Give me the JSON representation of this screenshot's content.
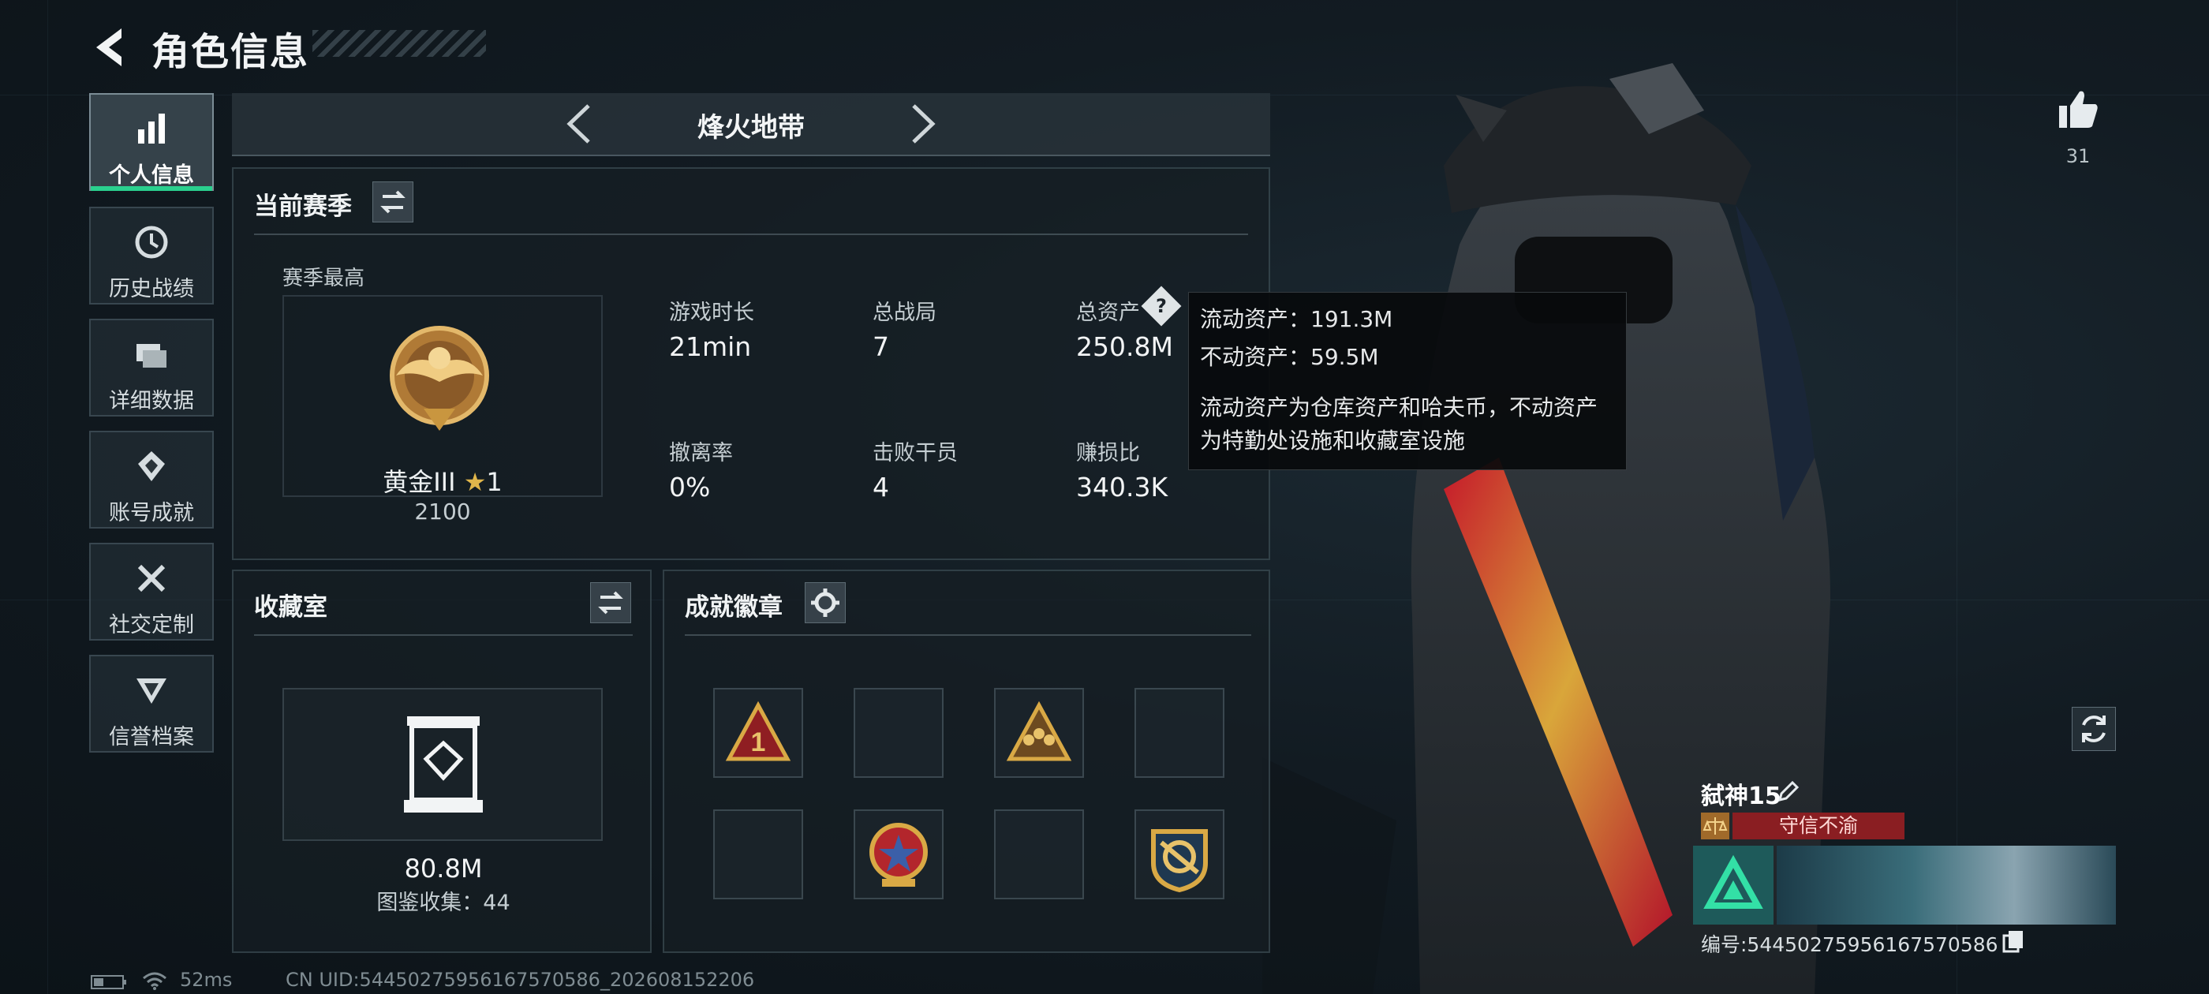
{
  "header": {
    "title": "角色信息"
  },
  "sidebar": {
    "items": [
      {
        "label": "个人信息",
        "icon": "bar-chart-icon",
        "active": true
      },
      {
        "label": "历史战绩",
        "icon": "history-clock-icon"
      },
      {
        "label": "详细数据",
        "icon": "folders-icon"
      },
      {
        "label": "账号成就",
        "icon": "achievement-icon"
      },
      {
        "label": "社交定制",
        "icon": "tools-icon"
      },
      {
        "label": "信誉档案",
        "icon": "credit-emblem-icon"
      }
    ]
  },
  "mode": {
    "label": "烽火地带"
  },
  "season": {
    "title": "当前赛季",
    "best_label": "赛季最高",
    "rank_name": "黄金III",
    "rank_stars": "1",
    "rank_points": "2100",
    "stats": [
      {
        "label": "游戏时长",
        "value": "21min"
      },
      {
        "label": "总战局",
        "value": "7"
      },
      {
        "label": "总资产",
        "value": "250.8M"
      },
      {
        "label": "撤离率",
        "value": "0%"
      },
      {
        "label": "击败干员",
        "value": "4"
      },
      {
        "label": "赚损比",
        "value": "340.3K"
      }
    ]
  },
  "tooltip": {
    "liquid": "流动资产：191.3M",
    "fixed": "不动资产：59.5M",
    "desc_line1": "流动资产为仓库资产和哈夫币，不动资产",
    "desc_line2": "为特勤处设施和收藏室设施"
  },
  "collection": {
    "title": "收藏室",
    "value": "80.8M",
    "subtitle": "图鉴收集：44"
  },
  "badges": {
    "title": "成就徽章",
    "slots": [
      "badge-triangle-1-icon",
      "",
      "badge-squad-icon",
      "",
      "",
      "badge-star-shield-icon",
      "",
      "badge-gear-crest-icon"
    ]
  },
  "player": {
    "likes": "31",
    "name": "弑神15",
    "honor": "守信不渝",
    "id_text": "编号:5445027595616757058​6"
  },
  "statusbar": {
    "ping": "52ms",
    "uid": "CN UID:5445027595616757058​6_202608152206"
  },
  "colors": {
    "accent_green": "#2ad08e",
    "honor_red": "#8a1e22",
    "gold": "#c9963f"
  }
}
